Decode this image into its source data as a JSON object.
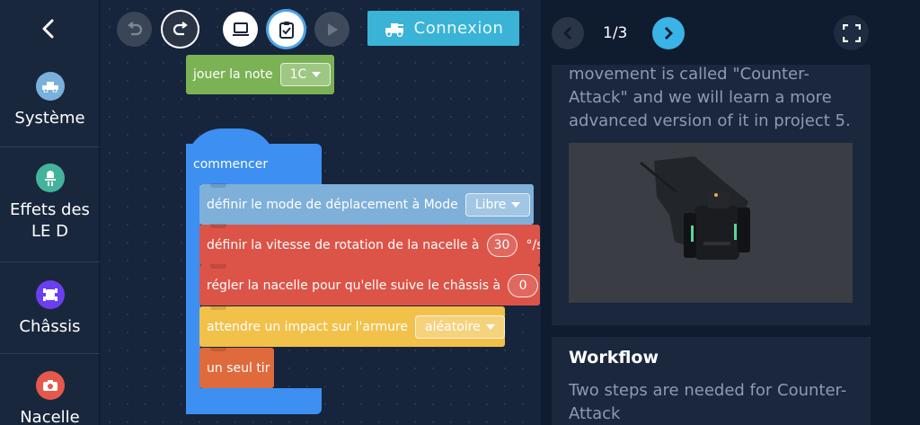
{
  "sidebar": {
    "categories": [
      {
        "label": "Système",
        "color": "#7ab0dc"
      },
      {
        "label": "Effets des LE D",
        "color": "#43b39b"
      },
      {
        "label": "Châssis",
        "color": "#6b3ff0"
      },
      {
        "label": "Nacelle",
        "color": "#e5584c"
      }
    ]
  },
  "toolbar": {
    "connect_label": "Connexion"
  },
  "blocks": {
    "play_note": {
      "label": "jouer la note",
      "value": "1C"
    },
    "start": {
      "label": "commencer"
    },
    "mode": {
      "label": "définir le mode de déplacement à  Mode",
      "value": "Libre"
    },
    "speed": {
      "label": "définir la vitesse de rotation de la nacelle à",
      "value": "30",
      "unit": "°/s"
    },
    "follow": {
      "label": "régler la nacelle pour qu'elle suive le châssis à",
      "value": "0",
      "unit": "°"
    },
    "wait": {
      "label": "attendre un impact sur l'armure",
      "value": "aléatoire"
    },
    "shoot": {
      "label": "un seul tir"
    }
  },
  "block_colors": {
    "looks": "#7bb255",
    "events": "#3d8ff1",
    "chassis": "#7fb0d9",
    "gimbal": "#dc5448",
    "sensor": "#f2c14a",
    "blaster": "#df6a3c"
  },
  "panel": {
    "page": "1/3",
    "card1_text": "movement is called \"Counter-Attack\" and we will learn a more advanced version of it in project 5.",
    "card2_title": "Workflow",
    "card2_text": "Two steps are needed for Counter-Attack"
  }
}
